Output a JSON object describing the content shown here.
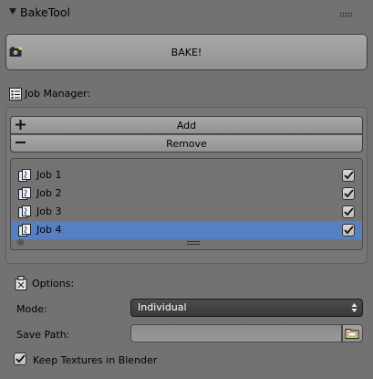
{
  "panel": {
    "title": "BakeTool"
  },
  "bake": {
    "label": "BAKE!"
  },
  "job_manager": {
    "label": "Job Manager:",
    "add_label": "Add",
    "remove_label": "Remove",
    "jobs": [
      {
        "name": "Job 1",
        "checked": true,
        "selected": false
      },
      {
        "name": "Job 2",
        "checked": true,
        "selected": false
      },
      {
        "name": "Job 3",
        "checked": true,
        "selected": false
      },
      {
        "name": "Job 4",
        "checked": true,
        "selected": true
      }
    ]
  },
  "options": {
    "label": "Options:",
    "mode_label": "Mode:",
    "mode_value": "Individual",
    "save_path_label": "Save Path:",
    "save_path_value": "",
    "keep_textures_label": "Keep Textures in Blender",
    "keep_textures_checked": true
  },
  "colors": {
    "background": "#727272",
    "selection": "#5680c2",
    "dropdown": "#424242"
  }
}
